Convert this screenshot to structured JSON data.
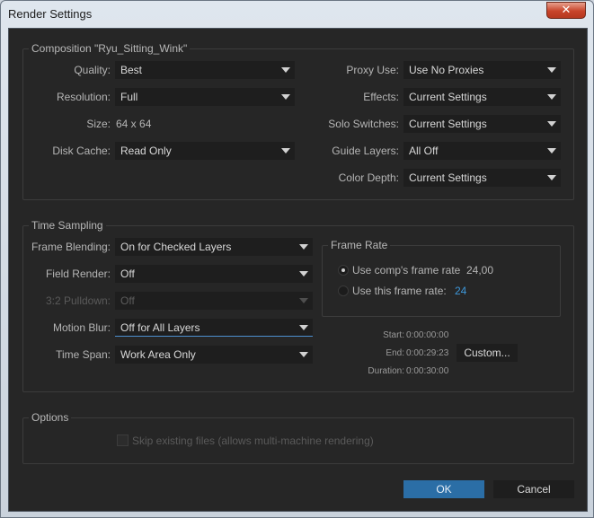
{
  "window": {
    "title": "Render Settings",
    "close_glyph": "✕"
  },
  "composition": {
    "group_title": "Composition \"Ryu_Sitting_Wink\"",
    "quality": {
      "label": "Quality:",
      "value": "Best"
    },
    "resolution": {
      "label": "Resolution:",
      "value": "Full"
    },
    "size": {
      "label": "Size:",
      "value": "64 x 64"
    },
    "disk_cache": {
      "label": "Disk Cache:",
      "value": "Read Only"
    },
    "proxy_use": {
      "label": "Proxy Use:",
      "value": "Use No Proxies"
    },
    "effects": {
      "label": "Effects:",
      "value": "Current Settings"
    },
    "solo_switches": {
      "label": "Solo Switches:",
      "value": "Current Settings"
    },
    "guide_layers": {
      "label": "Guide Layers:",
      "value": "All Off"
    },
    "color_depth": {
      "label": "Color Depth:",
      "value": "Current Settings"
    }
  },
  "time_sampling": {
    "group_title": "Time Sampling",
    "frame_blending": {
      "label": "Frame Blending:",
      "value": "On for Checked Layers"
    },
    "field_render": {
      "label": "Field Render:",
      "value": "Off"
    },
    "pulldown": {
      "label": "3:2 Pulldown:",
      "value": "Off"
    },
    "motion_blur": {
      "label": "Motion Blur:",
      "value": "Off for All Layers"
    },
    "time_span": {
      "label": "Time Span:",
      "value": "Work Area Only"
    },
    "frame_rate": {
      "group_title": "Frame Rate",
      "use_comp_label": "Use comp's frame rate",
      "use_comp_value": "24,00",
      "use_this_label": "Use this frame rate:",
      "use_this_value": "24",
      "selected": "use_comp"
    },
    "start": {
      "label": "Start:",
      "value": "0:00:00:00"
    },
    "end": {
      "label": "End:",
      "value": "0:00:29:23"
    },
    "duration": {
      "label": "Duration:",
      "value": "0:00:30:00"
    },
    "custom_button": "Custom..."
  },
  "options": {
    "group_title": "Options",
    "skip_existing_label": "Skip existing files (allows multi-machine rendering)",
    "skip_existing_checked": false
  },
  "buttons": {
    "ok": "OK",
    "cancel": "Cancel"
  },
  "colors": {
    "dialog_bg": "#262626",
    "field_bg": "#1e1e1e",
    "primary_button": "#2b6ea6",
    "accent_blue": "#3d96d8",
    "focus_underline": "#4d8fd0"
  }
}
